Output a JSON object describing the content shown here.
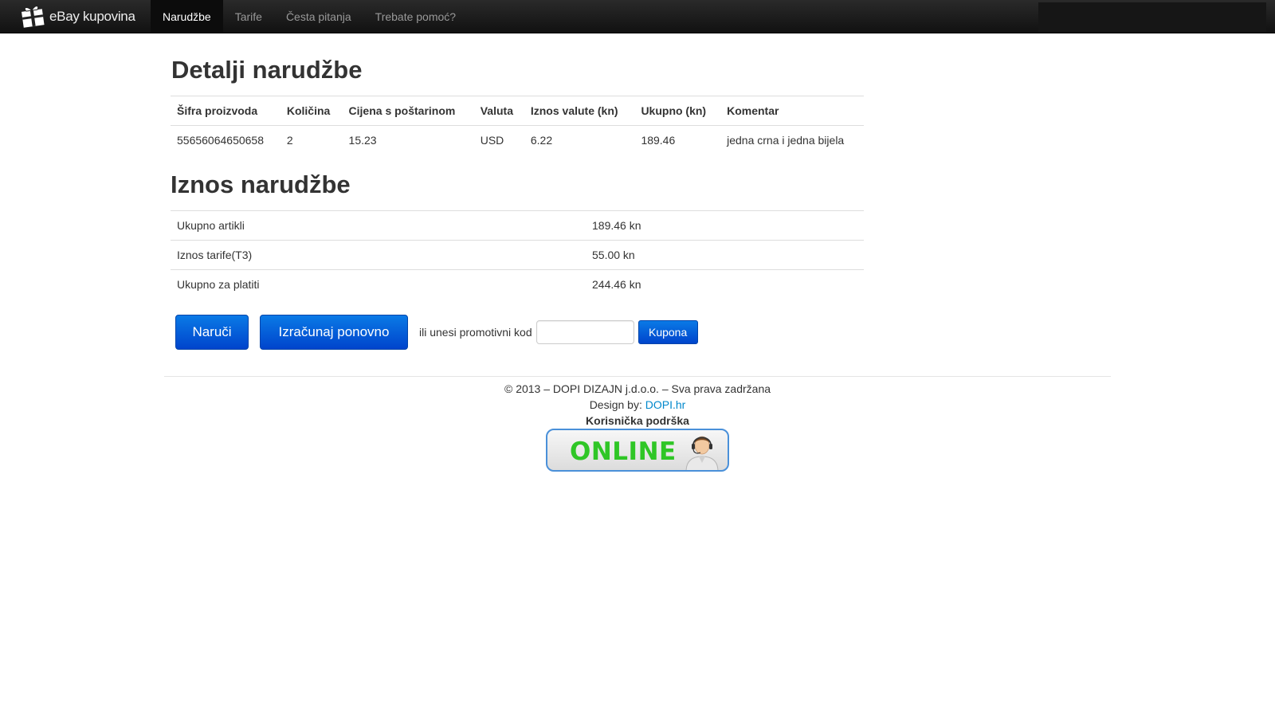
{
  "navbar": {
    "brand_text": "eBay kupovina",
    "brand_icon": "gift-box-icon",
    "items": [
      {
        "label": "Narudžbe",
        "active": true
      },
      {
        "label": "Tarife",
        "active": false
      },
      {
        "label": "Česta pitanja",
        "active": false
      },
      {
        "label": "Trebate pomoć?",
        "active": false
      }
    ]
  },
  "order_details": {
    "heading": "Detalji narudžbe",
    "columns": [
      "Šifra proizvoda",
      "Količina",
      "Cijena s poštarinom",
      "Valuta",
      "Iznos valute (kn)",
      "Ukupno (kn)",
      "Komentar"
    ],
    "rows": [
      [
        "55656064650658",
        "2",
        "15.23",
        "USD",
        "6.22",
        "189.46",
        "jedna crna i jedna bijela"
      ]
    ]
  },
  "order_amount": {
    "heading": "Iznos narudžbe",
    "rows": [
      {
        "label": "Ukupno artikli",
        "value": "189.46 kn"
      },
      {
        "label": "Iznos tarife(T3)",
        "value": "55.00 kn"
      },
      {
        "label": "Ukupno za platiti",
        "value": "244.46 kn"
      }
    ]
  },
  "actions": {
    "order_label": "Naruči",
    "recalculate_label": "Izračunaj ponovno",
    "promo_label": "ili unesi promotivni kod",
    "promo_value": "",
    "coupon_label": "Kupona"
  },
  "footer": {
    "copyright": "© 2013 – DOPI DIZAJN j.d.o.o. – Sva prava zadržana",
    "design_prefix": "Design by: ",
    "design_link": "DOPI.hr",
    "support_title": "Korisnička podrška",
    "online_label": "ONLINE"
  },
  "colors": {
    "navbar_bg": "#1b1b1b",
    "primary_button": "#0055cc",
    "link": "#0088cc",
    "online_green": "#2fc626"
  }
}
